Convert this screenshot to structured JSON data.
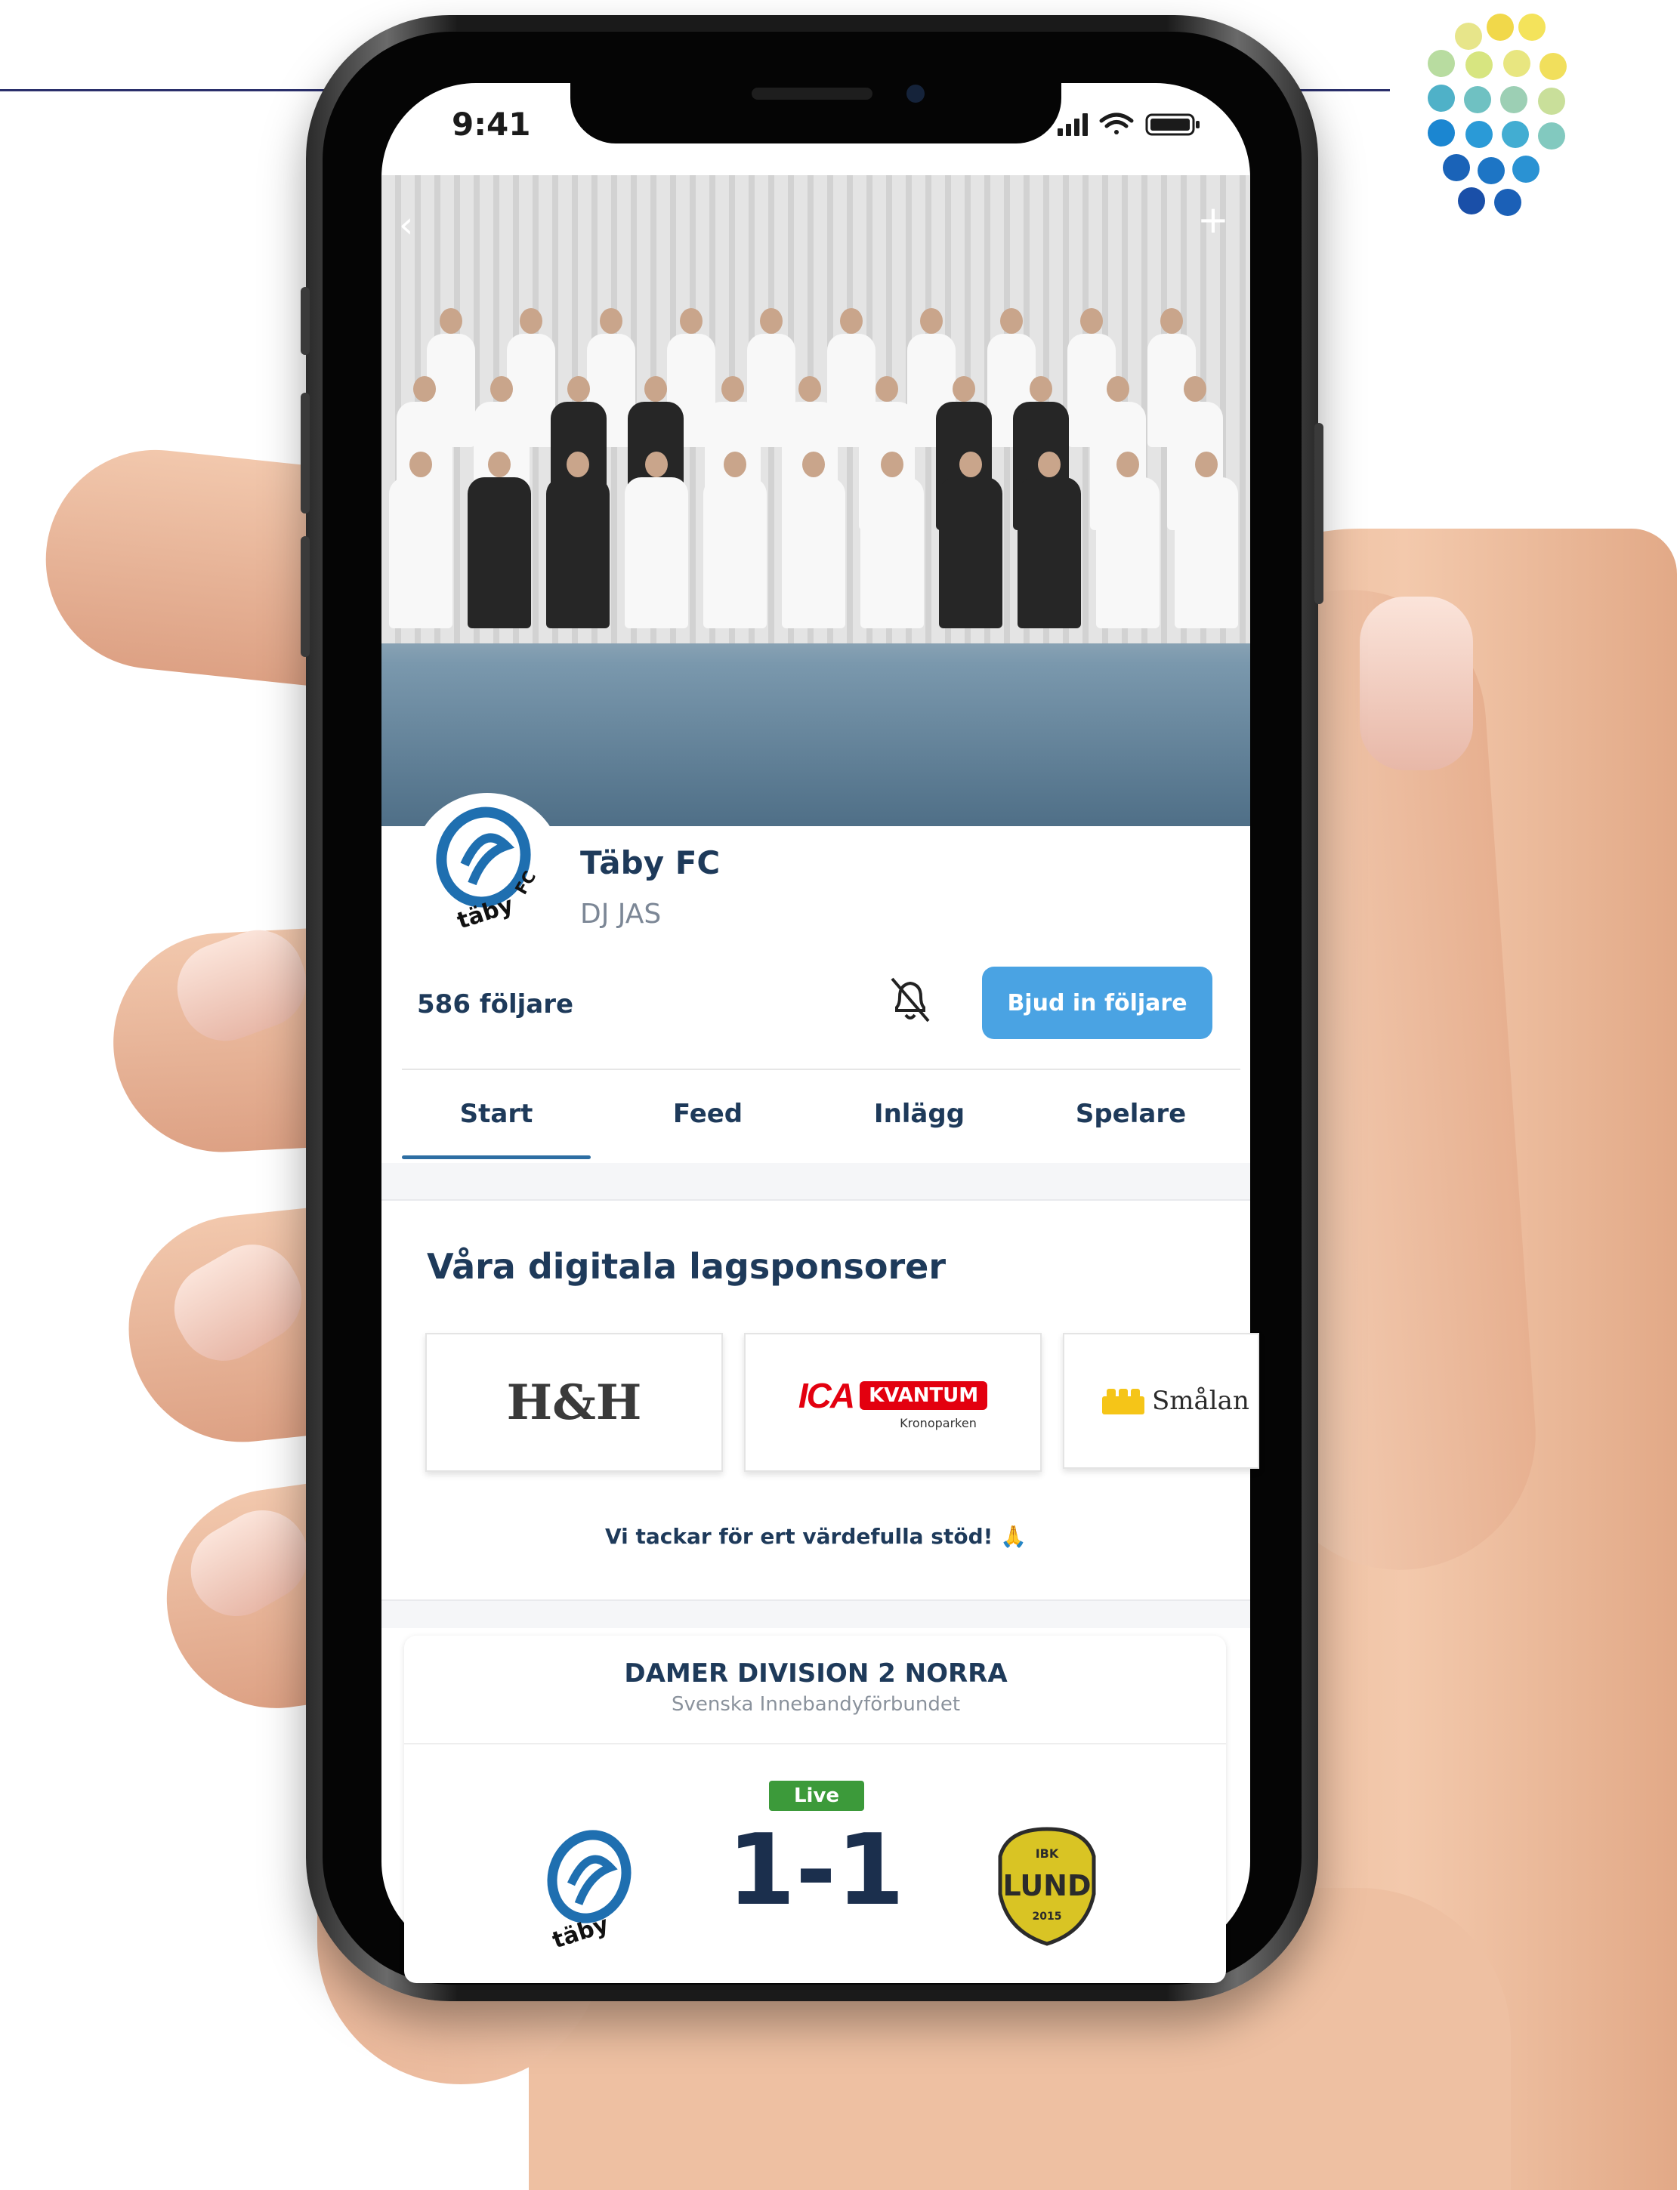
{
  "status_bar": {
    "time": "9:41"
  },
  "header": {
    "back_icon": "chevron-left-icon",
    "add_icon": "plus-icon"
  },
  "profile": {
    "team_name": "Täby FC",
    "subtitle": "DJ JAS",
    "followers": "586 följare",
    "invite_label": "Bjud in följare",
    "logo_text": "täby fc"
  },
  "tabs": [
    {
      "label": "Start",
      "active": true
    },
    {
      "label": "Feed",
      "active": false
    },
    {
      "label": "Inlägg",
      "active": false
    },
    {
      "label": "Spelare",
      "active": false
    }
  ],
  "sponsors": {
    "title": "Våra digitala lagsponsorer",
    "items": [
      {
        "name": "H&H"
      },
      {
        "name": "ICA",
        "badge": "KVANTUM",
        "sub": "Kronoparken"
      },
      {
        "name": "Smålan"
      }
    ],
    "thanks": "Vi tackar för ert värdefulla stöd! 🙏"
  },
  "match": {
    "league": "DAMER DIVISION 2 NORRA",
    "federation": "Svenska Innebandyförbundet",
    "status": "Live",
    "score": "1-1",
    "away_logo_text": "LUND",
    "away_logo_top": "IBK",
    "away_logo_year": "2015"
  },
  "colors": {
    "primary": "#1e3a5a",
    "accent": "#4aa3e3",
    "live": "#3c9a3a",
    "ica_red": "#e3000f"
  }
}
